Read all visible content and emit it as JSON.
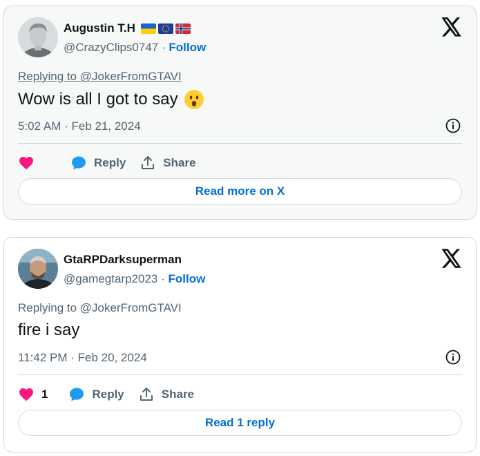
{
  "tweets": [
    {
      "author_name": "Augustin T.H",
      "flags": [
        "ukraine-flag",
        "eu-flag",
        "norway-flag"
      ],
      "handle": "@CrazyClips0747",
      "separator": "·",
      "follow_label": "Follow",
      "reply_to": "Replying to @JokerFromGTAVI",
      "text": "Wow is all I got to say",
      "emoji": "astonished-face-emoji",
      "timestamp": "5:02 AM · Feb 21, 2024",
      "like_count": "",
      "reply_label": "Reply",
      "share_label": "Share",
      "cta_label": "Read more on X"
    },
    {
      "author_name": "GtaRPDarksuperman",
      "flags": [],
      "handle": "@gamegtarp2023",
      "separator": "·",
      "follow_label": "Follow",
      "reply_to": "Replying to @JokerFromGTAVI",
      "text": "fire i say",
      "emoji": "",
      "timestamp": "11:42 PM · Feb 20, 2024",
      "like_count": "1",
      "reply_label": "Reply",
      "share_label": "Share",
      "cta_label": "Read 1 reply"
    }
  ],
  "colors": {
    "like": "#f91880",
    "reply": "#1d9bf0",
    "link": "#006fd6",
    "muted": "#536471",
    "border": "#cfd9de"
  }
}
